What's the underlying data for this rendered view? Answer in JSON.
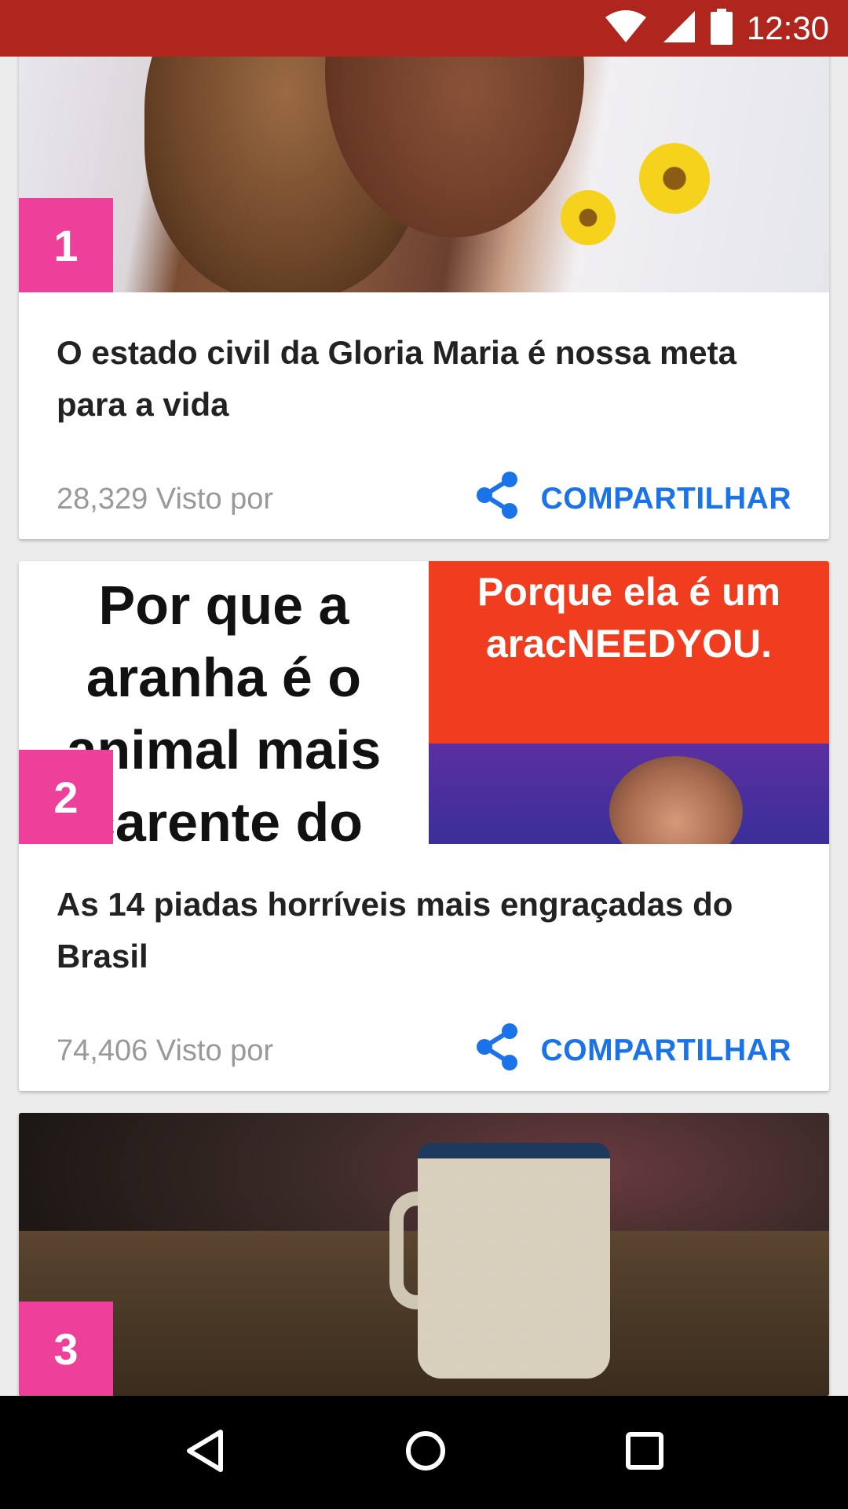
{
  "status_bar": {
    "time": "12:30"
  },
  "cards": [
    {
      "rank": "1",
      "title": "O estado civil da Gloria Maria é nossa meta para a vida",
      "views": "28,329 Visto por",
      "share_label": "COMPARTILHAR"
    },
    {
      "rank": "2",
      "title": "As 14 piadas horríveis mais engraçadas do Brasil",
      "views": "74,406 Visto por",
      "share_label": "COMPARTILHAR",
      "image_text_left": [
        "Por que a",
        "aranha é o",
        "animal mais",
        "carente do"
      ],
      "image_text_right": [
        "Porque ela é um",
        "aracNEEDYOU."
      ]
    },
    {
      "rank": "3"
    }
  ],
  "colors": {
    "status_bar": "#b0261c",
    "rank_badge": "#ee3f9b",
    "share_accent": "#1a73e8"
  },
  "icons": {
    "share": "share-icon",
    "back": "back-triangle-icon",
    "home": "home-circle-icon",
    "recents": "recents-square-icon"
  }
}
